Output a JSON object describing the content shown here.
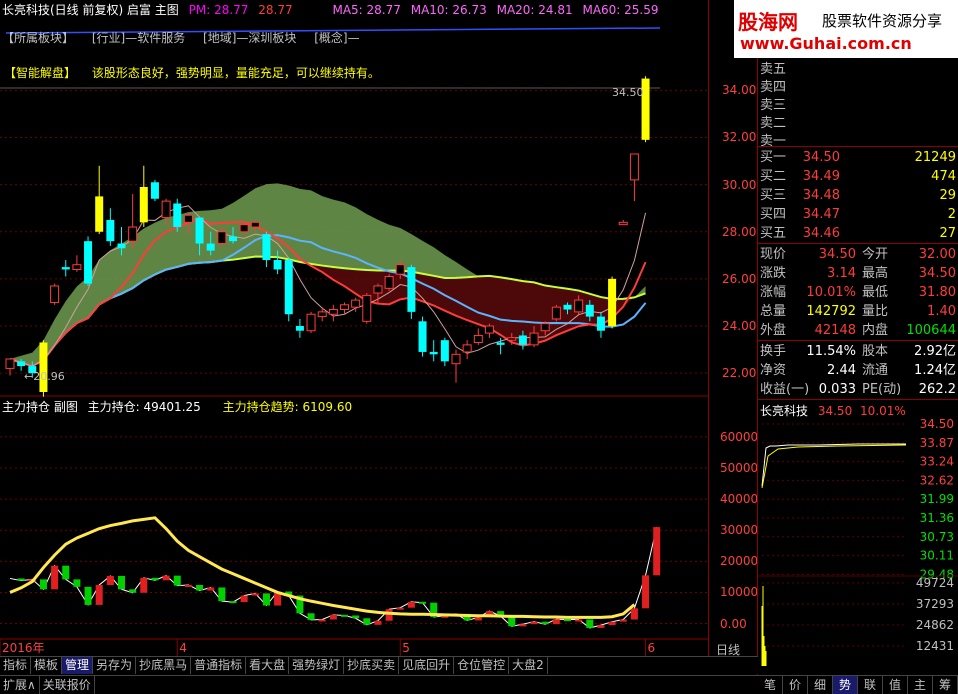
{
  "header": {
    "title": "长亮科技(日线 前复权) 启富 主图",
    "pm": "PM: 28.77",
    "pm2": "28.77",
    "ma5": "MA5: 28.77",
    "ma10": "MA10: 26.73",
    "ma20": "MA20: 24.81",
    "ma60": "MA60: 25.59"
  },
  "tags": [
    "【所属板块】",
    "[行业]—软件服务",
    "[地域]—深圳板块",
    "[概念]—"
  ],
  "analysis": {
    "label": "【智能解盘】",
    "text": "该股形态良好，强势明显，量能充足，可以继续持有。"
  },
  "main_axis": [
    "34.00",
    "32.00",
    "30.00",
    "28.00",
    "26.00",
    "24.00",
    "22.00"
  ],
  "high_label": "34.50",
  "low_label": "20.96",
  "sub_header": {
    "name": "主力持仓 副图",
    "pos_label": "主力持仓: 49401.25",
    "trend_label": "主力持仓趋势: 6109.60"
  },
  "sub_axis": [
    "60000",
    "50000",
    "40000",
    "30000",
    "20000",
    "10000",
    "0.00"
  ],
  "date_labels": [
    "2016年",
    "4",
    "5",
    "6"
  ],
  "period": "日线",
  "chart_data": {
    "type": "candlestick",
    "ylim": [
      21.2,
      35.5
    ],
    "candles": [
      [
        22.2,
        22.6,
        21.9,
        22.6
      ],
      [
        22.5,
        22.6,
        22.1,
        22.3
      ],
      [
        22.3,
        22.5,
        21.8,
        22.0
      ],
      [
        21.2,
        23.4,
        21.0,
        23.3
      ],
      [
        25.0,
        25.8,
        24.9,
        25.7
      ],
      [
        26.5,
        26.8,
        26.1,
        26.4
      ],
      [
        26.4,
        27.0,
        26.3,
        26.6
      ],
      [
        27.6,
        27.8,
        25.7,
        25.8
      ],
      [
        28.0,
        30.8,
        27.9,
        29.5
      ],
      [
        28.5,
        29.0,
        27.4,
        27.6
      ],
      [
        27.5,
        28.2,
        27.0,
        27.3
      ],
      [
        27.6,
        29.6,
        27.3,
        28.2
      ],
      [
        28.4,
        30.8,
        28.2,
        29.9
      ],
      [
        30.1,
        30.2,
        29.3,
        29.4
      ],
      [
        28.6,
        29.4,
        28.3,
        29.3
      ],
      [
        29.2,
        29.4,
        28.0,
        28.2
      ],
      [
        28.4,
        28.8,
        27.9,
        28.7
      ],
      [
        28.6,
        28.6,
        27.0,
        27.5
      ],
      [
        27.5,
        28.0,
        27.0,
        27.2
      ],
      [
        27.5,
        28.2,
        27.4,
        28.0
      ],
      [
        27.8,
        28.2,
        27.5,
        27.6
      ],
      [
        28.0,
        28.4,
        27.9,
        28.3
      ],
      [
        28.2,
        28.5,
        28.0,
        28.4
      ],
      [
        27.9,
        28.0,
        26.5,
        26.8
      ],
      [
        26.8,
        27.2,
        26.2,
        26.4
      ],
      [
        26.8,
        26.9,
        24.2,
        24.5
      ],
      [
        24.0,
        24.3,
        23.5,
        23.8
      ],
      [
        23.8,
        24.6,
        23.7,
        24.5
      ],
      [
        24.4,
        24.8,
        24.2,
        24.6
      ],
      [
        24.5,
        24.9,
        24.2,
        24.7
      ],
      [
        24.7,
        25.0,
        24.5,
        24.9
      ],
      [
        24.8,
        25.2,
        24.6,
        25.1
      ],
      [
        24.2,
        25.4,
        24.1,
        25.3
      ],
      [
        25.4,
        25.8,
        25.0,
        25.7
      ],
      [
        25.6,
        26.2,
        25.5,
        26.1
      ],
      [
        26.2,
        26.8,
        26.0,
        26.6
      ],
      [
        26.5,
        26.6,
        24.3,
        24.6
      ],
      [
        24.2,
        24.4,
        22.7,
        22.9
      ],
      [
        22.9,
        23.4,
        22.5,
        22.8
      ],
      [
        23.4,
        23.5,
        22.3,
        22.5
      ],
      [
        22.4,
        23.0,
        21.6,
        22.8
      ],
      [
        22.9,
        23.4,
        22.6,
        23.2
      ],
      [
        23.3,
        23.9,
        23.2,
        23.6
      ],
      [
        23.7,
        24.1,
        23.5,
        24.0
      ],
      [
        23.3,
        23.5,
        22.8,
        23.2
      ],
      [
        23.4,
        23.7,
        23.2,
        23.5
      ],
      [
        23.6,
        23.8,
        23.0,
        23.2
      ],
      [
        23.2,
        24.0,
        23.1,
        23.7
      ],
      [
        23.8,
        24.2,
        23.6,
        24.1
      ],
      [
        24.3,
        24.9,
        24.2,
        24.8
      ],
      [
        24.9,
        25.0,
        24.5,
        24.7
      ],
      [
        24.6,
        25.3,
        24.5,
        25.1
      ],
      [
        24.9,
        25.1,
        24.2,
        24.4
      ],
      [
        24.4,
        24.6,
        23.5,
        23.8
      ],
      [
        24.0,
        26.1,
        23.9,
        26.0
      ],
      [
        28.3,
        28.5,
        28.3,
        28.4
      ],
      [
        30.2,
        31.3,
        29.3,
        31.3
      ],
      [
        31.9,
        34.6,
        31.8,
        34.5
      ]
    ]
  },
  "sub_chart": {
    "ylim": [
      -4000,
      68000
    ],
    "pos": [
      14500,
      13800,
      14200,
      11000,
      18600,
      14200,
      11800,
      6000,
      12400,
      15300,
      11000,
      9900,
      14700,
      13900,
      15400,
      12200,
      12400,
      10600,
      11600,
      7200,
      6900,
      9000,
      9700,
      5800,
      10300,
      9000,
      3300,
      1200,
      1300,
      2800,
      2600,
      1700,
      -400,
      900,
      4600,
      5100,
      7000,
      6700,
      2100,
      2500,
      3100,
      1000,
      2000,
      4000,
      2400,
      -900,
      -200,
      600,
      -200,
      1400,
      1300,
      1300,
      -1400,
      -500,
      600,
      1300,
      4900,
      15500,
      31000
    ],
    "trend": [
      10000,
      11500,
      13500,
      18000,
      22000,
      25500,
      27500,
      29000,
      30500,
      31500,
      32200,
      33000,
      33500,
      34000,
      30500,
      26500,
      23500,
      21500,
      19500,
      17500,
      16000,
      14500,
      13000,
      11500,
      10000,
      9000,
      8000,
      7200,
      6500,
      5800,
      5200,
      4600,
      4000,
      3600,
      3300,
      3100,
      3000,
      3000,
      2900,
      2800,
      2700,
      2600,
      2500,
      2500,
      2400,
      2300,
      2300,
      2200,
      2100,
      2100,
      2000,
      2000,
      2000,
      2000,
      2200,
      3100,
      6109
    ]
  },
  "quote": {
    "sell": [
      {
        "label": "卖五"
      },
      {
        "label": "卖四"
      },
      {
        "label": "卖三"
      },
      {
        "label": "卖二"
      },
      {
        "label": "卖一"
      }
    ],
    "buy": [
      {
        "label": "买一",
        "price": "34.50",
        "vol": "21249"
      },
      {
        "label": "买二",
        "price": "34.49",
        "vol": "474"
      },
      {
        "label": "买三",
        "price": "34.48",
        "vol": "29"
      },
      {
        "label": "买四",
        "price": "34.47",
        "vol": "2"
      },
      {
        "label": "买五",
        "price": "34.46",
        "vol": "27"
      }
    ],
    "stats": [
      {
        "a": "现价",
        "av": "34.50",
        "ac": "red",
        "b": "今开",
        "bv": "32.00",
        "bc": "red"
      },
      {
        "a": "涨跌",
        "av": "3.14",
        "ac": "red",
        "b": "最高",
        "bv": "34.50",
        "bc": "red"
      },
      {
        "a": "涨幅",
        "av": "10.01%",
        "ac": "red",
        "b": "最低",
        "bv": "31.80",
        "bc": "red"
      },
      {
        "a": "总量",
        "av": "142792",
        "ac": "yellow",
        "b": "量比",
        "bv": "1.40",
        "bc": "red"
      },
      {
        "a": "外盘",
        "av": "42148",
        "ac": "red",
        "b": "内盘",
        "bv": "100644",
        "bc": "green"
      },
      {
        "a": "换手",
        "av": "11.54%",
        "ac": "white",
        "b": "股本",
        "bv": "2.92亿",
        "bc": "white"
      },
      {
        "a": "净资",
        "av": "2.44",
        "ac": "white",
        "b": "流通",
        "bv": "1.24亿",
        "bc": "white"
      },
      {
        "a": "收益(一)",
        "av": "0.033",
        "ac": "white",
        "b": "PE(动)",
        "bv": "262.2",
        "bc": "white"
      }
    ]
  },
  "mini": {
    "name": "长亮科技",
    "price": "34.50",
    "pct": "10.01%",
    "price_axis": [
      "34.50",
      "33.87",
      "33.24",
      "32.62",
      "31.99",
      "31.36",
      "30.73",
      "30.11",
      "29.48"
    ],
    "vol_axis": [
      "49724",
      "37293",
      "24862",
      "12431"
    ]
  },
  "tabs_bottom": [
    "笔",
    "价",
    "细",
    "势",
    "联",
    "值",
    "主",
    "筹"
  ],
  "toolbar": [
    "指标",
    "模板",
    "管理",
    "另存为",
    "抄底黑马",
    "普通指标",
    "看大盘",
    "强势绿灯",
    "抄底买卖",
    "见底回升",
    "仓位管控",
    "大盘2"
  ],
  "toolbar2": [
    "扩展∧",
    "关联报价"
  ],
  "logo": {
    "name": "股海网",
    "slogan": "股票软件资源分享",
    "url": "www.Guhai.com.cn"
  },
  "colors": {
    "up": "#ff3c3c",
    "down": "#00ffff",
    "ma5": "#ffffff",
    "ma10": "#ff3c3c",
    "ma20": "#5ab4ff",
    "ma60": "#c8ff3c",
    "band": "#6f9c4f",
    "trend": "#ffe850"
  }
}
